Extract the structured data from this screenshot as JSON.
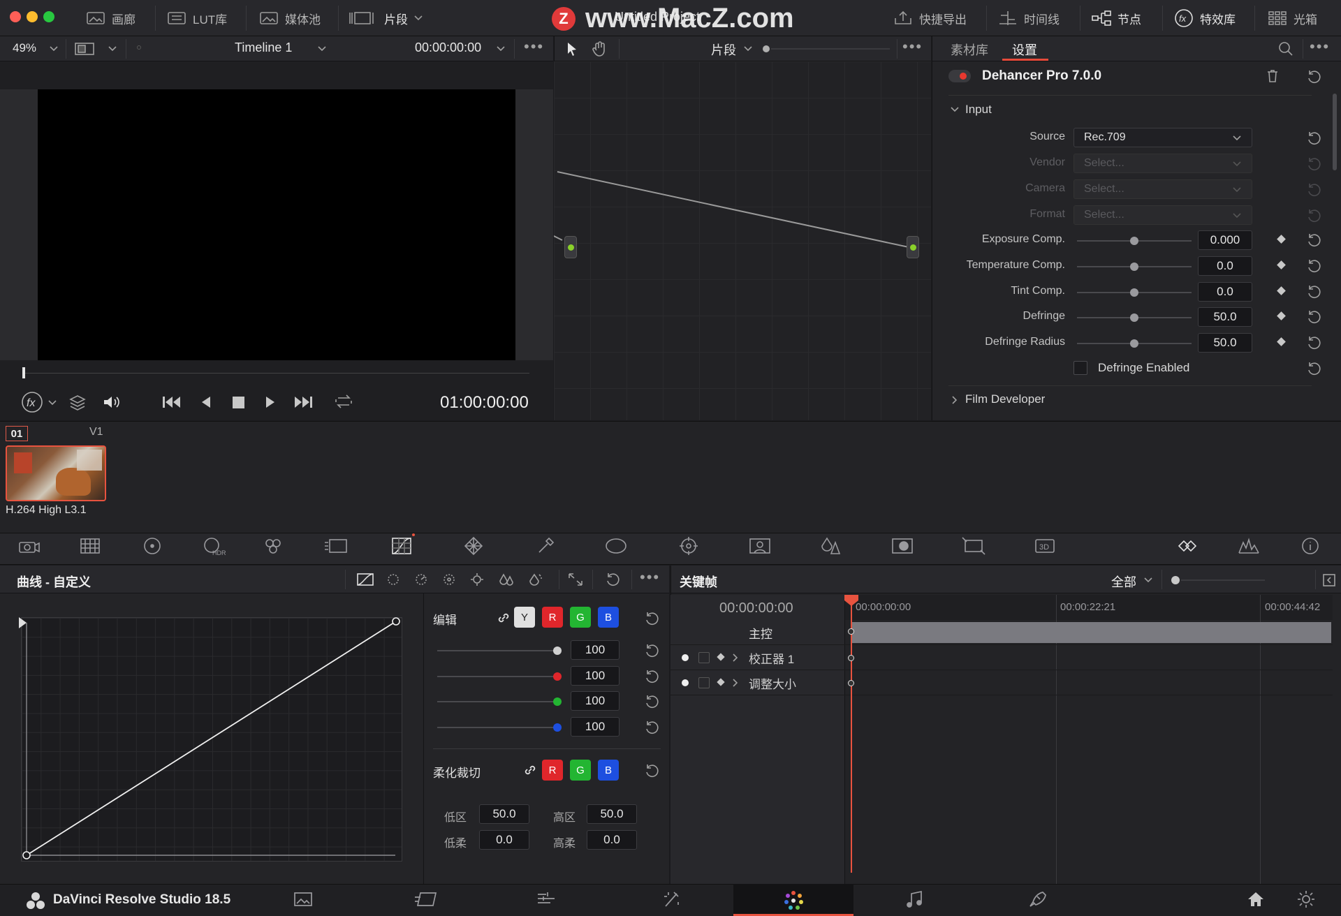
{
  "watermark": "www.MacZ.com",
  "watermark_logo": "Z",
  "project_title": "Untitled Project",
  "top_tabs": [
    {
      "label": "画廊",
      "icon": "gallery-icon"
    },
    {
      "label": "LUT库",
      "icon": "lut-icon"
    },
    {
      "label": "媒体池",
      "icon": "media-pool-icon"
    },
    {
      "label": "片段",
      "icon": "clips-icon"
    }
  ],
  "top_right_tabs": [
    {
      "label": "快捷导出",
      "icon": "export-icon"
    },
    {
      "label": "时间线",
      "icon": "timeline-icon"
    },
    {
      "label": "节点",
      "icon": "nodes-icon"
    },
    {
      "label": "特效库",
      "icon": "fx-library-icon"
    },
    {
      "label": "光箱",
      "icon": "lightbox-icon"
    }
  ],
  "viewer": {
    "zoom": "49%",
    "timeline_name": "Timeline 1",
    "timecode_top": "00:00:00:00",
    "timecode_bottom": "01:00:00:00"
  },
  "node_editor": {
    "mode_label": "片段"
  },
  "inspector": {
    "tabs": [
      "素材库",
      "设置"
    ],
    "active_tab": "设置",
    "plugin_name": "Dehancer Pro 7.0.0",
    "section_input": "Input",
    "section_film": "Film Developer",
    "dropdowns": [
      {
        "label": "Source",
        "value": "Rec.709",
        "enabled": true
      },
      {
        "label": "Vendor",
        "value": "Select...",
        "enabled": false
      },
      {
        "label": "Camera",
        "value": "Select...",
        "enabled": false
      },
      {
        "label": "Format",
        "value": "Select...",
        "enabled": false
      }
    ],
    "params": [
      {
        "label": "Exposure Comp.",
        "value": "0.000"
      },
      {
        "label": "Temperature Comp.",
        "value": "0.0"
      },
      {
        "label": "Tint Comp.",
        "value": "0.0"
      },
      {
        "label": "Defringe",
        "value": "50.0"
      },
      {
        "label": "Defringe Radius",
        "value": "50.0"
      }
    ],
    "checkbox_label": "Defringe Enabled"
  },
  "clip": {
    "index": "01",
    "track": "V1",
    "codec": "H.264 High L3.1"
  },
  "curves": {
    "title": "曲线 - 自定义",
    "edit_label": "编辑",
    "channels": [
      "Y",
      "R",
      "G",
      "B"
    ],
    "channel_colors": {
      "Y": "#e0e0e0",
      "R": "#e0262b",
      "G": "#23b532",
      "B": "#1d4fe0"
    },
    "intensities": [
      "100",
      "100",
      "100",
      "100"
    ],
    "soft_clip_label": "柔化裁切",
    "low_label": "低区",
    "low_value": "50.0",
    "high_label": "高区",
    "high_value": "50.0",
    "low_soft_label": "低柔",
    "low_soft_value": "0.0",
    "high_soft_label": "高柔",
    "high_soft_value": "0.0"
  },
  "keyframes": {
    "title": "关键帧",
    "filter": "全部",
    "timecode": "00:00:00:00",
    "ruler": [
      "00:00:00:00",
      "00:00:22:21",
      "00:00:44:42"
    ],
    "rows": [
      "主控",
      "校正器 1",
      "调整大小"
    ]
  },
  "app_name": "DaVinci Resolve Studio 18.5"
}
